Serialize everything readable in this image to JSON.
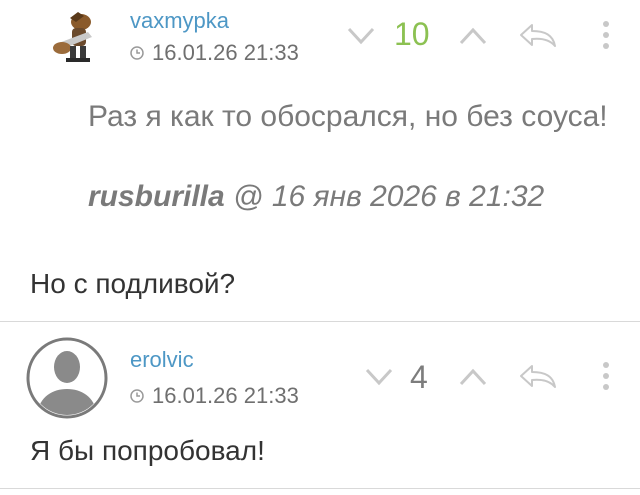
{
  "comments": [
    {
      "username": "vaxmypka",
      "timestamp": "16.01.26 21:33",
      "score": "10",
      "score_color": "#8cc152",
      "quote_text": "Раз я как то обосрался, но без соуса!",
      "quote_author": "rusburilla",
      "quote_date": "@ 16 янв 2026 в 21:32",
      "text": "Но с подливой?"
    },
    {
      "username": "erolvic",
      "timestamp": "16.01.26 21:33",
      "score": "4",
      "score_color": "#7d7d7d",
      "text": "Я бы попробовал!"
    }
  ],
  "colors": {
    "username": "#4d97c5",
    "icon": "#c8c8c8",
    "divider": "#d9d9d9"
  },
  "icons": [
    "clock-icon",
    "vote-down-icon",
    "vote-up-icon",
    "reply-icon",
    "more-icon",
    "default-avatar-icon"
  ]
}
